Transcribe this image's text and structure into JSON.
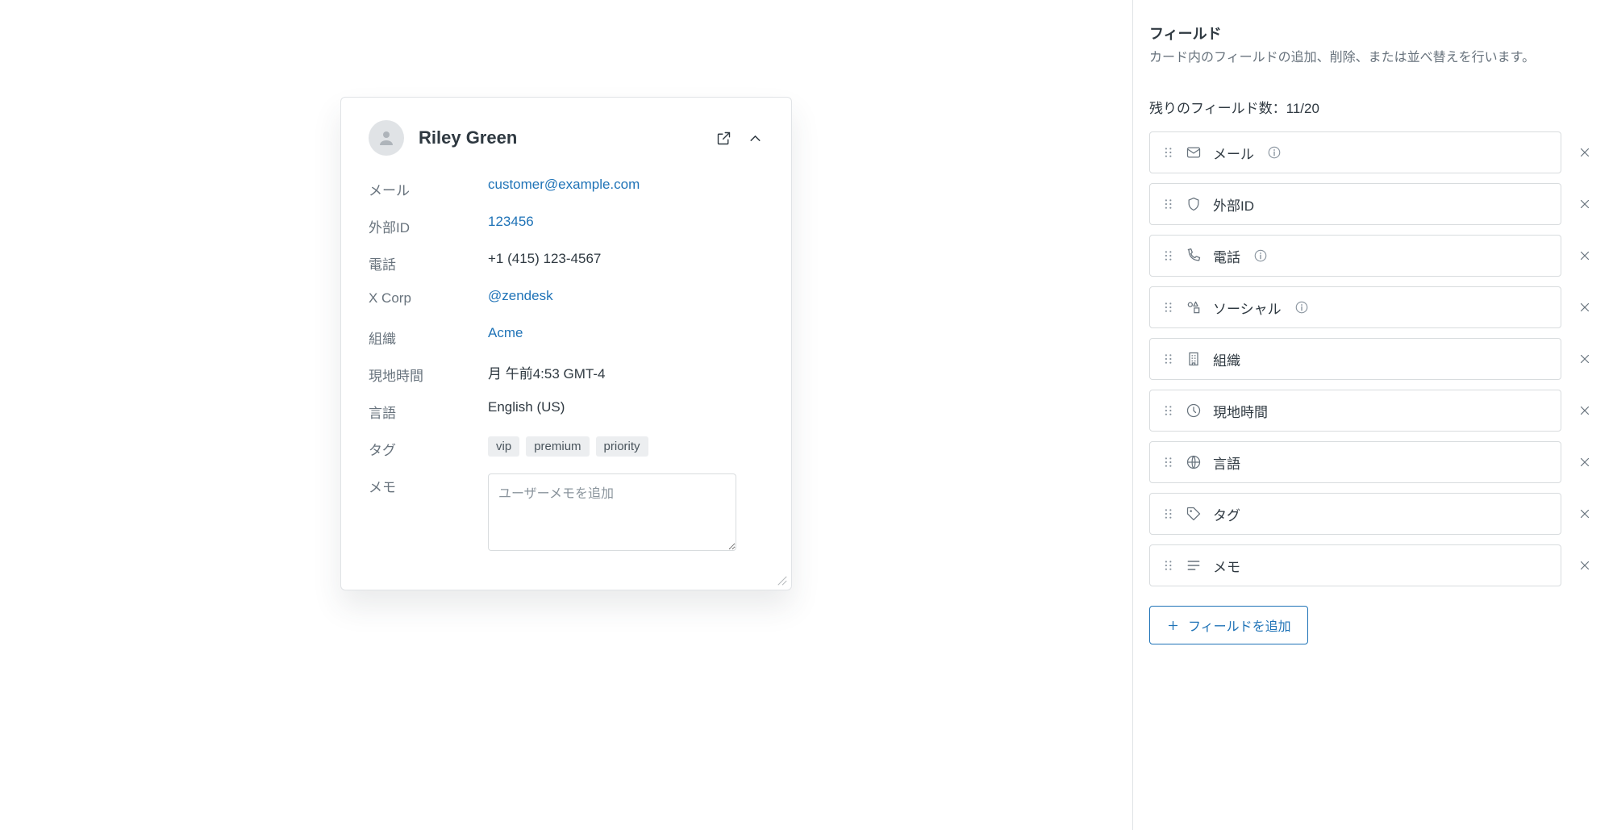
{
  "card": {
    "user_name": "Riley Green",
    "fields": {
      "email": {
        "label": "メール",
        "value": "customer@example.com",
        "link": true
      },
      "external_id": {
        "label": "外部ID",
        "value": "123456",
        "link": true
      },
      "phone": {
        "label": "電話",
        "value": "+1 (415) 123-4567",
        "link": false
      },
      "xcorp": {
        "label": "X Corp",
        "value": "@zendesk",
        "link": true
      },
      "org": {
        "label": "組織",
        "value": "Acme",
        "link": true
      },
      "localtime": {
        "label": "現地時間",
        "value": "月 午前4:53 GMT-4",
        "link": false
      },
      "language": {
        "label": "言語",
        "value": "English (US)",
        "link": false
      },
      "tags": {
        "label": "タグ",
        "values": [
          "vip",
          "premium",
          "priority"
        ]
      },
      "memo": {
        "label": "メモ",
        "placeholder": "ユーザーメモを追加"
      }
    }
  },
  "panel": {
    "title": "フィールド",
    "subtitle": "カード内のフィールドの追加、削除、または並べ替えを行います。",
    "remaining_label": "残りのフィールド数：11/20",
    "add_button": "フィールドを追加",
    "items": [
      {
        "icon": "mail",
        "label": "メール",
        "info": true
      },
      {
        "icon": "shield",
        "label": "外部ID",
        "info": false
      },
      {
        "icon": "phone",
        "label": "電話",
        "info": true
      },
      {
        "icon": "shapes",
        "label": "ソーシャル",
        "info": true
      },
      {
        "icon": "building",
        "label": "組織",
        "info": false
      },
      {
        "icon": "clock",
        "label": "現地時間",
        "info": false
      },
      {
        "icon": "globe",
        "label": "言語",
        "info": false
      },
      {
        "icon": "tag",
        "label": "タグ",
        "info": false
      },
      {
        "icon": "notes",
        "label": "メモ",
        "info": false
      }
    ]
  }
}
